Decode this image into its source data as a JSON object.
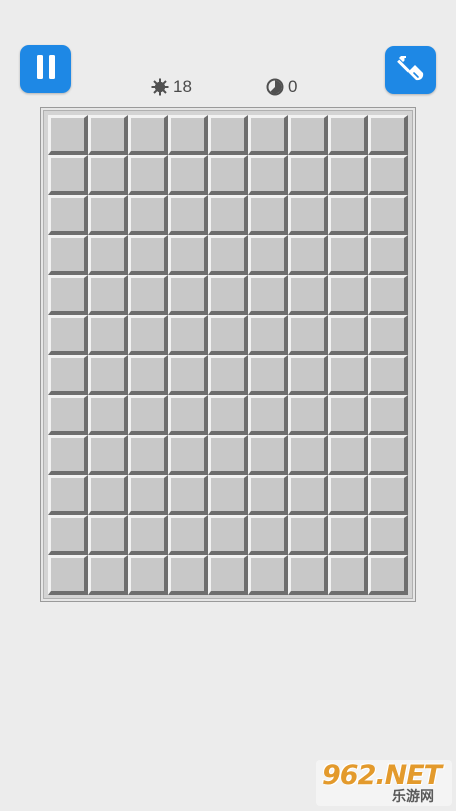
{
  "toolbar": {
    "pause_icon": "pause-icon",
    "shovel_icon": "shovel-icon",
    "accent_color": "#1e88e5"
  },
  "stats": {
    "mines_icon": "mine-icon",
    "mines_remaining": "18",
    "timer_icon": "clock-icon",
    "time_elapsed": "0"
  },
  "board": {
    "columns": 9,
    "rows": 12,
    "cell_state": "unrevealed"
  },
  "watermark": {
    "main": "962.NET",
    "sub": "乐游网"
  }
}
